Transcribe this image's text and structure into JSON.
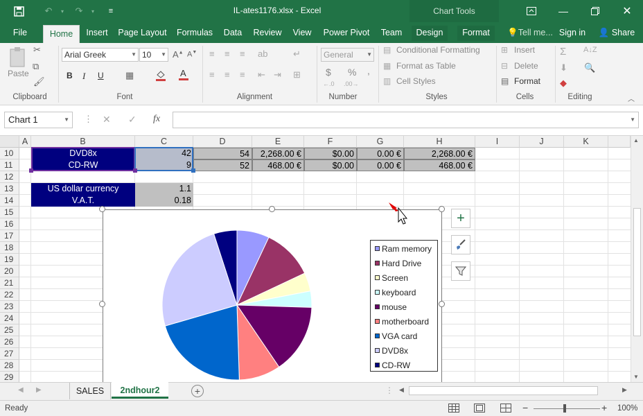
{
  "titlebar": {
    "title": "IL-ates1176.xlsx - Excel",
    "chart_tools": "Chart Tools",
    "save_icon": "save-icon",
    "undo_icon": "undo-icon",
    "redo_icon": "redo-icon",
    "customize_icon": "customize-qat-icon"
  },
  "tabs": {
    "file": "File",
    "home": "Home",
    "insert": "Insert",
    "page_layout": "Page Layout",
    "formulas": "Formulas",
    "data": "Data",
    "review": "Review",
    "view": "View",
    "power_pivot": "Power Pivot",
    "team": "Team",
    "design": "Design",
    "format": "Format",
    "tell_me": "Tell me...",
    "sign_in": "Sign in",
    "share": "Share"
  },
  "ribbon": {
    "clipboard": {
      "paste": "Paste",
      "label": "Clipboard"
    },
    "font": {
      "name": "Arial Greek",
      "size": "10",
      "bold": "B",
      "italic": "I",
      "underline": "U",
      "label": "Font"
    },
    "alignment": {
      "label": "Alignment"
    },
    "number": {
      "format": "General",
      "currency": "$",
      "percent": "%",
      "comma": ",",
      "label": "Number"
    },
    "styles": {
      "conditional": "Conditional Formatting",
      "format_table": "Format as Table",
      "cell_styles": "Cell Styles",
      "label": "Styles"
    },
    "cells": {
      "insert": "Insert",
      "delete": "Delete",
      "format": "Format",
      "label": "Cells"
    },
    "editing": {
      "label": "Editing"
    }
  },
  "formula_bar": {
    "name_box": "Chart 1",
    "fx": "fx",
    "value": ""
  },
  "columns": [
    "A",
    "B",
    "C",
    "D",
    "E",
    "F",
    "G",
    "H",
    "I",
    "J",
    "K"
  ],
  "rows": [
    "10",
    "11",
    "12",
    "13",
    "14",
    "15",
    "16",
    "17",
    "18",
    "19",
    "20",
    "21",
    "22",
    "23",
    "24",
    "25",
    "26",
    "27",
    "28",
    "29"
  ],
  "cells": {
    "r10": {
      "b": "DVD8x",
      "c": "42",
      "d": "54",
      "e": "2,268.00 €",
      "f": "$0.00",
      "g": "0.00 €",
      "h": "2,268.00 €"
    },
    "r11": {
      "b": "CD-RW",
      "c": "9",
      "d": "52",
      "e": "468.00 €",
      "f": "$0.00",
      "g": "0.00 €",
      "h": "468.00 €"
    },
    "r13": {
      "b": "US dollar currency",
      "c": "1.1"
    },
    "r14": {
      "b": "V.A.T.",
      "c": "0.18"
    }
  },
  "chart_data": {
    "type": "pie",
    "categories": [
      "Ram memory",
      "Hard Drive",
      "Screen",
      "keyboard",
      "mouse",
      "motherboard",
      "VGA card",
      "DVD8x",
      "CD-RW"
    ],
    "values": [
      7,
      11,
      4,
      3.5,
      15,
      9,
      21,
      24.5,
      5
    ],
    "colors": [
      "#9999ff",
      "#993366",
      "#ffffcc",
      "#ccffff",
      "#660066",
      "#ff8080",
      "#0066cc",
      "#ccccff",
      "#000080"
    ],
    "legend_position": "right"
  },
  "sheets": {
    "sheet1": "SALES",
    "sheet2": "2ndhour2"
  },
  "status": {
    "ready": "Ready",
    "zoom": "100%"
  }
}
